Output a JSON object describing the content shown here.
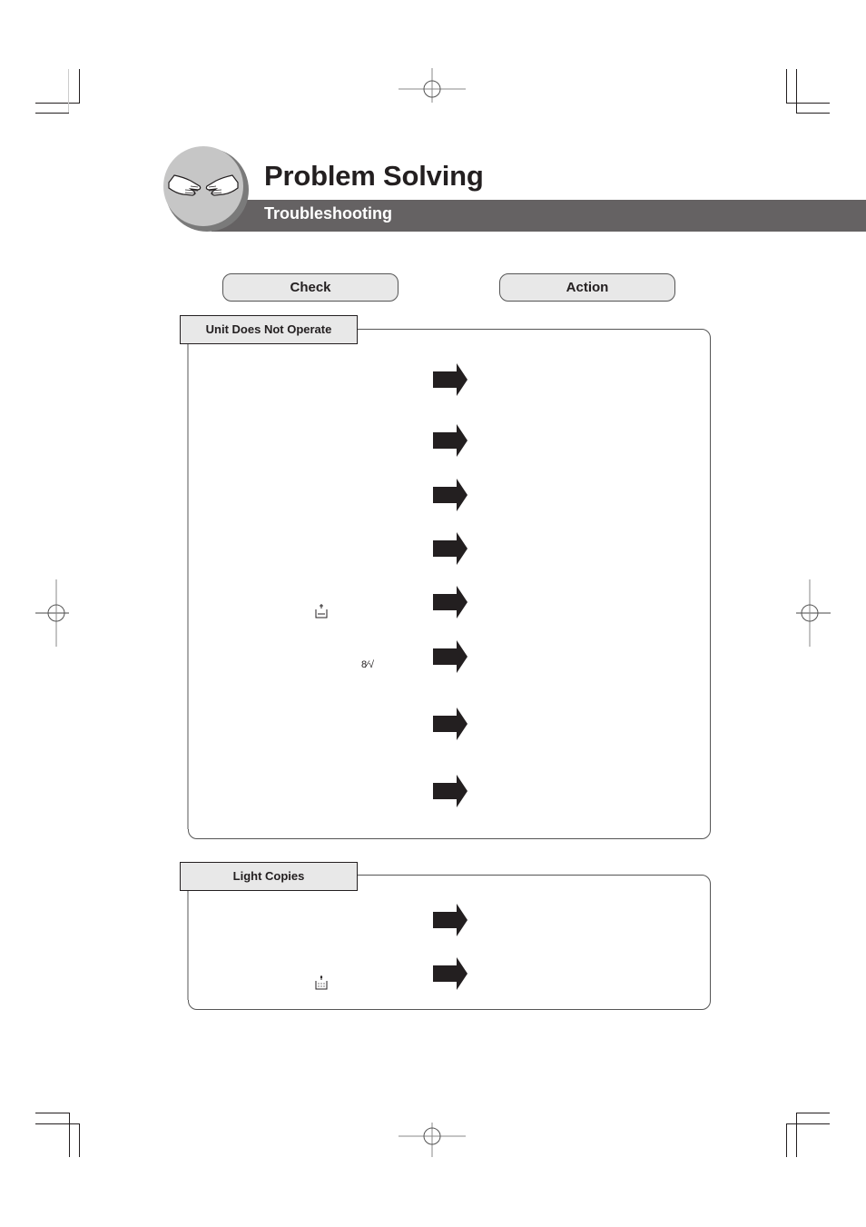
{
  "header": {
    "badge_icon": "handshake-icon",
    "title": "Problem Solving",
    "subtitle": "Troubleshooting"
  },
  "columns": {
    "check_label": "Check",
    "action_label": "Action"
  },
  "sections": [
    {
      "title": "Unit Does Not Operate",
      "rows": [
        {
          "check_icon": null,
          "arrow_icon": "arrow-right-icon"
        },
        {
          "check_icon": null,
          "arrow_icon": "arrow-right-icon"
        },
        {
          "check_icon": null,
          "arrow_icon": "arrow-right-icon"
        },
        {
          "check_icon": null,
          "arrow_icon": "arrow-right-icon"
        },
        {
          "check_icon": "add-paper-icon",
          "arrow_icon": "arrow-right-icon"
        },
        {
          "check_icon": "paper-jam-icon",
          "arrow_icon": "arrow-right-icon"
        },
        {
          "check_icon": null,
          "arrow_icon": "arrow-right-icon"
        },
        {
          "check_icon": null,
          "arrow_icon": "arrow-right-icon"
        }
      ]
    },
    {
      "title": "Light Copies",
      "rows": [
        {
          "check_icon": null,
          "arrow_icon": "arrow-right-icon"
        },
        {
          "check_icon": "add-toner-icon",
          "arrow_icon": "arrow-right-icon"
        }
      ]
    }
  ],
  "icons": {
    "paper_jam_glyph": "8∕√"
  }
}
